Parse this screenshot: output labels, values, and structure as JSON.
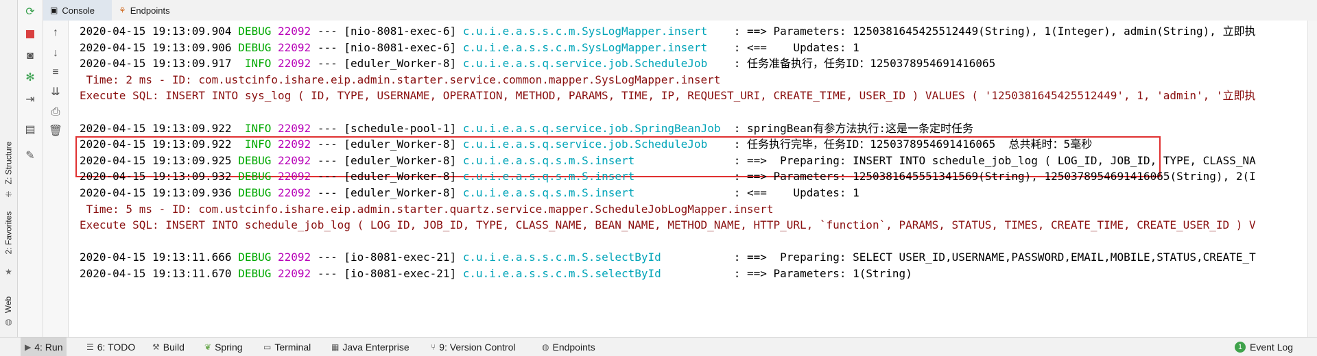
{
  "left_stripe": {
    "items": [
      {
        "label": "Z: Structure",
        "icon": "structure-icon"
      },
      {
        "label": "2: Favorites",
        "icon": "star-icon"
      },
      {
        "label": "Web",
        "icon": "web-icon"
      }
    ]
  },
  "tabs": [
    {
      "label": "Console",
      "icon": "console-icon",
      "active": true
    },
    {
      "label": "Endpoints",
      "icon": "endpoints-icon",
      "active": false
    }
  ],
  "toolbar": {
    "left": [
      "rerun-icon",
      "stop-icon",
      "camera-icon",
      "debug-bug-icon",
      "exit-icon",
      "layout-icon",
      "pin-icon"
    ],
    "right": [
      "up-arrow-icon",
      "down-arrow-icon",
      "soft-wrap-icon",
      "scroll-to-end-icon",
      "print-icon",
      "trash-icon"
    ]
  },
  "log": {
    "lines": [
      {
        "ts": "2020-04-15 19:13:09.904",
        "level": "DEBUG",
        "pid": "22092",
        "sep": "---",
        "thread": "[nio-8081-exec-6]",
        "logger": "c.u.i.e.a.s.s.c.m.SysLogMapper.insert",
        "msg": ": ==> Parameters: 1250381645425512449(String), 1(Integer), admin(String), 立即执"
      },
      {
        "ts": "2020-04-15 19:13:09.906",
        "level": "DEBUG",
        "pid": "22092",
        "sep": "---",
        "thread": "[nio-8081-exec-6]",
        "logger": "c.u.i.e.a.s.s.c.m.SysLogMapper.insert",
        "msg": ": <==    Updates: 1"
      },
      {
        "ts": "2020-04-15 19:13:09.917",
        "level": "INFO",
        "pid": "22092",
        "sep": "---",
        "thread": "[eduler_Worker-8]",
        "logger": "c.u.i.e.a.s.q.service.job.ScheduleJob",
        "msg": ": 任务准备执行，任务ID：1250378954691416065"
      },
      {
        "red": " Time: 2 ms - ID: com.ustcinfo.ishare.eip.admin.starter.service.common.mapper.SysLogMapper.insert"
      },
      {
        "red": "Execute SQL: INSERT INTO sys_log ( ID, TYPE, USERNAME, OPERATION, METHOD, PARAMS, TIME, IP, REQUEST_URI, CREATE_TIME, USER_ID ) VALUES ( '1250381645425512449', 1, 'admin', '立即执"
      },
      {
        "blank": true
      },
      {
        "ts": "2020-04-15 19:13:09.922",
        "level": "INFO",
        "pid": "22092",
        "sep": "---",
        "thread": "[schedule-pool-1]",
        "logger": "c.u.i.e.a.s.q.service.job.SpringBeanJob",
        "msg": ": springBean有参方法执行:这是一条定时任务"
      },
      {
        "ts": "2020-04-15 19:13:09.922",
        "level": "INFO",
        "pid": "22092",
        "sep": "---",
        "thread": "[eduler_Worker-8]",
        "logger": "c.u.i.e.a.s.q.service.job.ScheduleJob",
        "msg": ": 任务执行完毕，任务ID：1250378954691416065  总共耗时：5毫秒"
      },
      {
        "ts": "2020-04-15 19:13:09.925",
        "level": "DEBUG",
        "pid": "22092",
        "sep": "---",
        "thread": "[eduler_Worker-8]",
        "logger": "c.u.i.e.a.s.q.s.m.S.insert",
        "msg": ": ==>  Preparing: INSERT INTO schedule_job_log ( LOG_ID, JOB_ID, TYPE, CLASS_NA"
      },
      {
        "ts": "2020-04-15 19:13:09.932",
        "level": "DEBUG",
        "pid": "22092",
        "sep": "---",
        "thread": "[eduler_Worker-8]",
        "logger": "c.u.i.e.a.s.q.s.m.S.insert",
        "msg": ": ==> Parameters: 1250381645551341569(String), 1250378954691416065(String), 2(I"
      },
      {
        "ts": "2020-04-15 19:13:09.936",
        "level": "DEBUG",
        "pid": "22092",
        "sep": "---",
        "thread": "[eduler_Worker-8]",
        "logger": "c.u.i.e.a.s.q.s.m.S.insert",
        "msg": ": <==    Updates: 1"
      },
      {
        "red": " Time: 5 ms - ID: com.ustcinfo.ishare.eip.admin.starter.quartz.service.mapper.ScheduleJobLogMapper.insert"
      },
      {
        "red": "Execute SQL: INSERT INTO schedule_job_log ( LOG_ID, JOB_ID, TYPE, CLASS_NAME, BEAN_NAME, METHOD_NAME, HTTP_URL, `function`, PARAMS, STATUS, TIMES, CREATE_TIME, CREATE_USER_ID ) V"
      },
      {
        "blank": true
      },
      {
        "ts": "2020-04-15 19:13:11.666",
        "level": "DEBUG",
        "pid": "22092",
        "sep": "---",
        "thread": "[io-8081-exec-21]",
        "logger": "c.u.i.e.a.s.s.c.m.S.selectById",
        "msg": ": ==>  Preparing: SELECT USER_ID,USERNAME,PASSWORD,EMAIL,MOBILE,STATUS,CREATE_T"
      },
      {
        "ts": "2020-04-15 19:13:11.670",
        "level": "DEBUG",
        "pid": "22092",
        "sep": "---",
        "thread": "[io-8081-exec-21]",
        "logger": "c.u.i.e.a.s.s.c.m.S.selectById",
        "msg": ": ==> Parameters: 1(String)"
      }
    ]
  },
  "bottom_bar": {
    "items": [
      {
        "label": "4: Run",
        "icon": "run-icon",
        "active": true
      },
      {
        "label": "6: TODO",
        "icon": "todo-icon"
      },
      {
        "label": "Build",
        "icon": "build-icon"
      },
      {
        "label": "Spring",
        "icon": "spring-icon"
      },
      {
        "label": "Terminal",
        "icon": "terminal-icon"
      },
      {
        "label": "Java Enterprise",
        "icon": "java-enterprise-icon"
      },
      {
        "label": "9: Version Control",
        "icon": "version-control-icon"
      },
      {
        "label": "Endpoints",
        "icon": "endpoints-icon"
      }
    ],
    "event_log": {
      "label": "Event Log",
      "count": "1"
    }
  },
  "colors": {
    "debug": "#00a800",
    "info": "#00a800",
    "pid": "#b800b8",
    "logger": "#00a4b8",
    "sql": "#8a1010",
    "highlight_border": "#e03030"
  }
}
